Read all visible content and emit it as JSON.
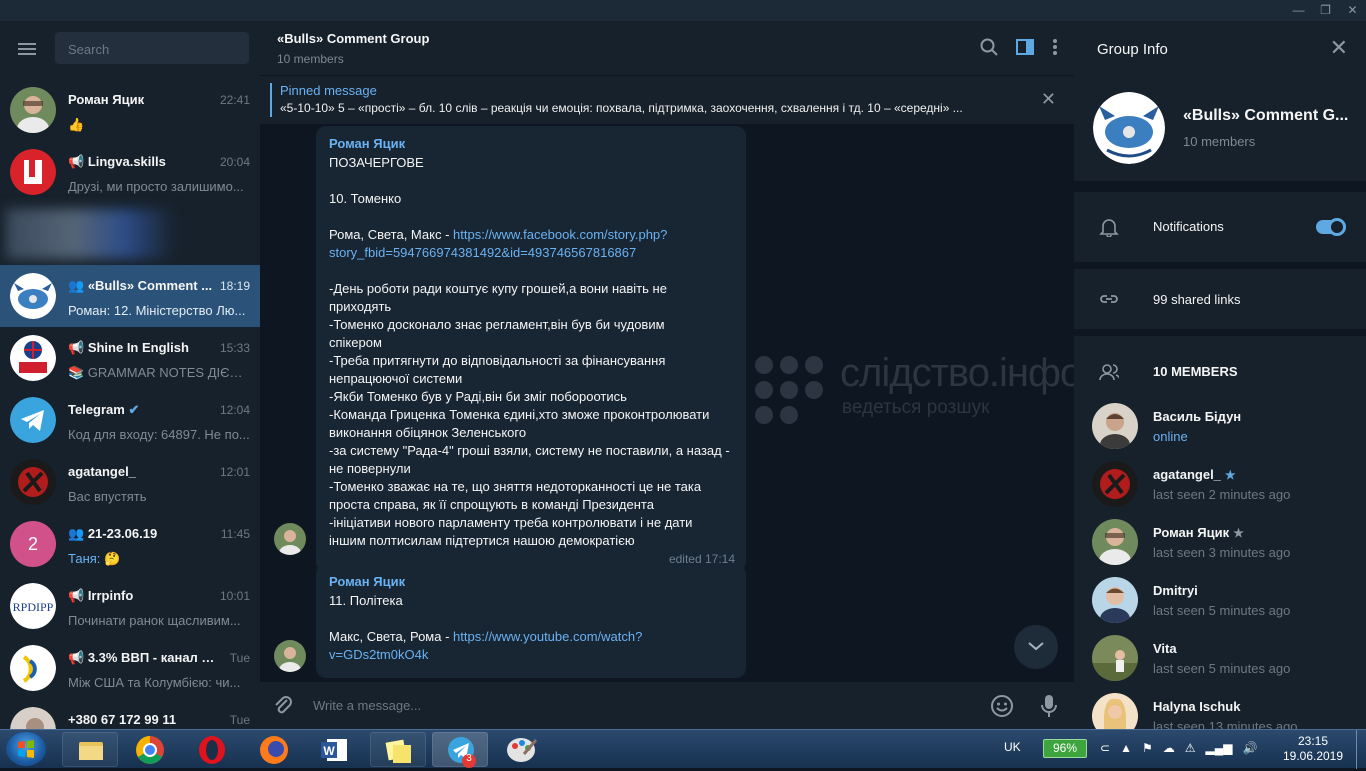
{
  "sidebar": {
    "search_placeholder": "Search",
    "dialogs": [
      {
        "name": "Роман Яцик",
        "time": "22:41",
        "preview": "👍",
        "type": "user"
      },
      {
        "name": "Lingva.skills",
        "time": "20:04",
        "preview": "Друзі, ми просто залишимо...",
        "type": "channel"
      },
      {
        "name": "",
        "time": "",
        "preview": "",
        "type": "hidden"
      },
      {
        "name": "«Bulls» Comment ...",
        "time": "18:19",
        "preview": "Роман: 12. Міністерство Лю...",
        "type": "group",
        "active": true
      },
      {
        "name": "Shine In English",
        "time": "15:33",
        "preview": "📚 GRAMMAR NOTES ДІЄСЛ...",
        "type": "channel"
      },
      {
        "name": "Telegram",
        "time": "12:04",
        "preview": "Код для входу: 64897. Не по...",
        "type": "verified"
      },
      {
        "name": "agatangel_",
        "time": "12:01",
        "preview": "Вас впустять",
        "type": "user"
      },
      {
        "name": "21-23.06.19",
        "time": "11:45",
        "preview_sender": "Таня:",
        "preview": " 🤔",
        "type": "group",
        "avatar_letter": "2"
      },
      {
        "name": "Irrpinfo",
        "time": "10:01",
        "preview": "Починати ранок щасливим...",
        "type": "channel"
      },
      {
        "name": "3.3% ВВП - канал V...",
        "time": "Tue",
        "preview": "Між США та Колумбією: чи...",
        "type": "channel"
      },
      {
        "name": "+380 67 172 99 11",
        "time": "Tue",
        "preview": "",
        "type": "user"
      }
    ]
  },
  "chat": {
    "title": "«Bulls» Comment Group",
    "subtitle": "10 members",
    "pinned_label": "Pinned message",
    "pinned_text": "«5-10-10»  5 – «прості» – бл. 10 слів – реакція чи емоція: похвала, підтримка, заохочення, схвалення і тд. 10 – «середні» ...",
    "messages": [
      {
        "author": "Роман Яцик",
        "lines": [
          "ПОЗАЧЕРГОВЕ",
          "",
          "10. Томенко",
          "",
          "Рома, Света, Макс - ",
          "story_fbid=594766974381492&id=493746567816867",
          "",
          "-День роботи ради коштує купу грошей,а вони навіть не",
          "приходять",
          "-Томенко досконало знає регламент,він був би чудовим",
          "спікером",
          "-Треба притягнути до відповідальності за фінансування",
          "непрацюючої системи",
          "-Якби Томенко був у Раді,він би зміг побороотись",
          "-Команда Гриценка Томенка єдині,хто зможе проконтролювати",
          "виконання обіцянок Зеленського",
          "-за систему \"Рада-4\" гроші взяли, систему не поставили, а назад -",
          "не повернули",
          "-Томенко зважає на те, що зняття недоторканності це не така",
          "проста справа, як її спрощують в команді Президента",
          "-ініціативи нового парламенту треба контролювати і не дати",
          "іншим полтисилам підтертися нашою демократією"
        ],
        "link_part1": "https://www.facebook.com/story.php?",
        "edited": "edited 17:14"
      },
      {
        "author": "Роман Яцик",
        "lines": [
          "11. Політека",
          "",
          "Макс, Света, Рома - "
        ],
        "link_part1": "https://www.youtube.com/watch?",
        "link_part2": "v=GDs2tm0kO4k"
      }
    ],
    "watermark_title": "слідство.інфо",
    "watermark_sub": "ведеться розшук",
    "composer_placeholder": "Write a message..."
  },
  "info": {
    "title": "Group Info",
    "group_name": "«Bulls» Comment G...",
    "group_members": "10 members",
    "notifications_label": "Notifications",
    "notifications_on": true,
    "shared_links": "99 shared links",
    "members_header": "10 MEMBERS",
    "members": [
      {
        "name": "Василь Бідун",
        "status": "online",
        "online": true,
        "star": false
      },
      {
        "name": "agatangel_",
        "status": "last seen 2 minutes ago",
        "star": true
      },
      {
        "name": "Роман Яцик",
        "status": "last seen 3 minutes ago",
        "star": true
      },
      {
        "name": "Dmitryi",
        "status": "last seen 5 minutes ago",
        "star": false
      },
      {
        "name": "Vita",
        "status": "last seen 5 minutes ago",
        "star": false
      },
      {
        "name": "Halyna Ischuk",
        "status": "last seen 13 minutes ago",
        "star": false
      }
    ]
  },
  "taskbar": {
    "language": "UK",
    "battery": "96%",
    "time": "23:15",
    "date": "19.06.2019",
    "telegram_badge": "3",
    "apps": [
      "explorer-icon",
      "chrome-icon",
      "opera-icon",
      "firefox-icon",
      "word-icon",
      "sticky-notes-icon",
      "telegram-icon",
      "paint-icon"
    ]
  },
  "colors": {
    "accent": "#5fa9e3",
    "link": "#6ab2f2",
    "active_dialog": "#2b5278",
    "bg": "#0e1621",
    "panel": "#17212b"
  }
}
